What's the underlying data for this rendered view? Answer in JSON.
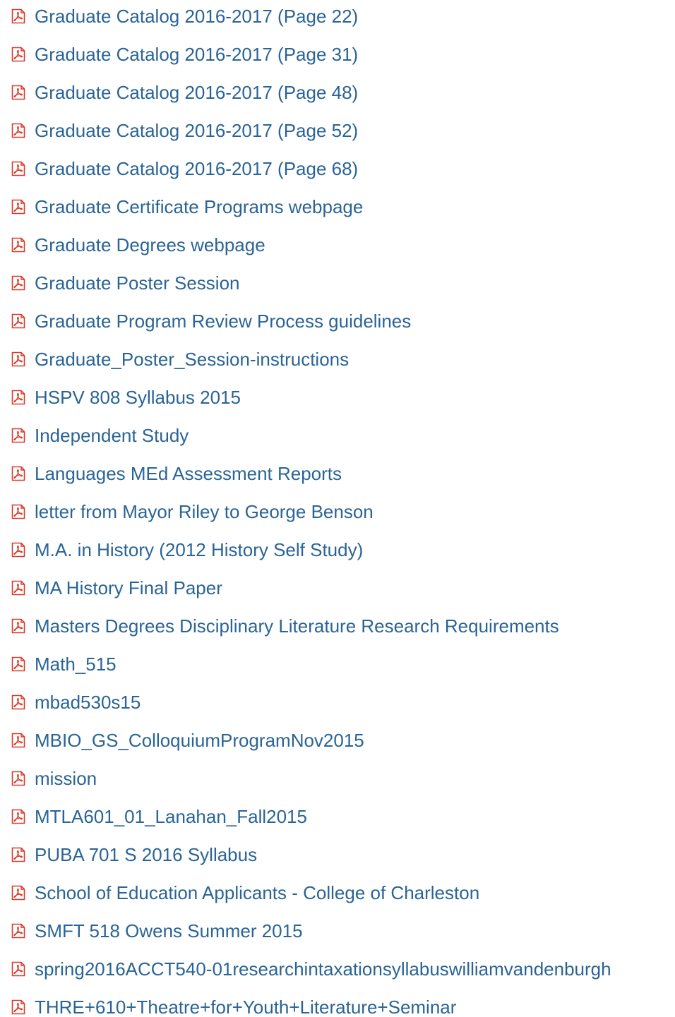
{
  "accent_color": "#2a6496",
  "icon_color": "#d93a2b",
  "documents": [
    {
      "title": "Graduate Catalog 2016-2017 (Page 22)",
      "icon": "pdf-icon"
    },
    {
      "title": "Graduate Catalog 2016-2017 (Page 31)",
      "icon": "pdf-icon"
    },
    {
      "title": "Graduate Catalog 2016-2017 (Page 48)",
      "icon": "pdf-icon"
    },
    {
      "title": "Graduate Catalog 2016-2017 (Page 52)",
      "icon": "pdf-icon"
    },
    {
      "title": "Graduate Catalog 2016-2017 (Page 68)",
      "icon": "pdf-icon"
    },
    {
      "title": "Graduate Certificate Programs webpage",
      "icon": "pdf-icon"
    },
    {
      "title": "Graduate Degrees webpage",
      "icon": "pdf-icon"
    },
    {
      "title": "Graduate Poster Session",
      "icon": "pdf-icon"
    },
    {
      "title": "Graduate Program Review Process guidelines",
      "icon": "pdf-icon"
    },
    {
      "title": "Graduate_Poster_Session-instructions",
      "icon": "pdf-icon"
    },
    {
      "title": "HSPV 808 Syllabus 2015",
      "icon": "pdf-icon"
    },
    {
      "title": "Independent Study",
      "icon": "pdf-icon"
    },
    {
      "title": "Languages MEd Assessment Reports",
      "icon": "pdf-icon"
    },
    {
      "title": "letter from Mayor Riley to George Benson",
      "icon": "pdf-icon"
    },
    {
      "title": "M.A. in History (2012 History Self Study)",
      "icon": "pdf-icon"
    },
    {
      "title": "MA History Final Paper",
      "icon": "pdf-icon"
    },
    {
      "title": "Masters Degrees Disciplinary Literature Research Requirements",
      "icon": "pdf-icon"
    },
    {
      "title": "Math_515",
      "icon": "pdf-icon"
    },
    {
      "title": "mbad530s15",
      "icon": "pdf-icon"
    },
    {
      "title": "MBIO_GS_ColloquiumProgramNov2015",
      "icon": "pdf-icon"
    },
    {
      "title": "mission",
      "icon": "pdf-icon"
    },
    {
      "title": "MTLA601_01_Lanahan_Fall2015",
      "icon": "pdf-icon"
    },
    {
      "title": "PUBA 701 S 2016 Syllabus",
      "icon": "pdf-icon"
    },
    {
      "title": "School of Education Applicants - College of Charleston",
      "icon": "pdf-icon"
    },
    {
      "title": "SMFT 518 Owens Summer 2015",
      "icon": "pdf-icon"
    },
    {
      "title": "spring2016ACCT540-01researchintaxationsyllabuswilliamvandenburgh",
      "icon": "pdf-icon"
    },
    {
      "title": "THRE+610+Theatre+for+Youth+Literature+Seminar",
      "icon": "pdf-icon"
    }
  ]
}
